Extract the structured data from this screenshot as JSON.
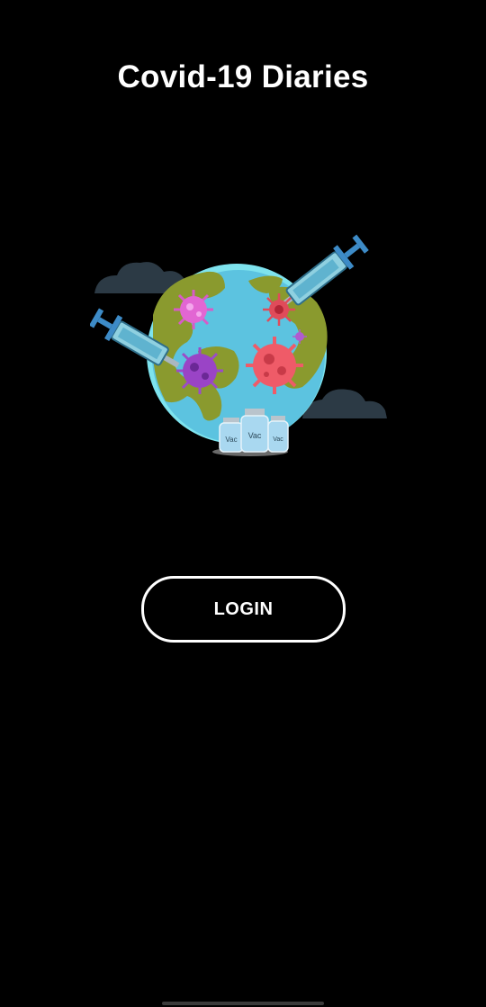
{
  "app": {
    "title": "Covid-19 Diaries"
  },
  "login": {
    "label": "LOGIN"
  },
  "illustration": {
    "vial_labels": [
      "Vac",
      "Vac",
      "Vac"
    ]
  },
  "colors": {
    "background": "#000000",
    "text": "#ffffff",
    "ocean": "#5cc3e0",
    "land": "#8a9a2e",
    "cloud": "#2c3a45"
  },
  "icons": {
    "illustration": "globe-vaccine-illustration"
  }
}
